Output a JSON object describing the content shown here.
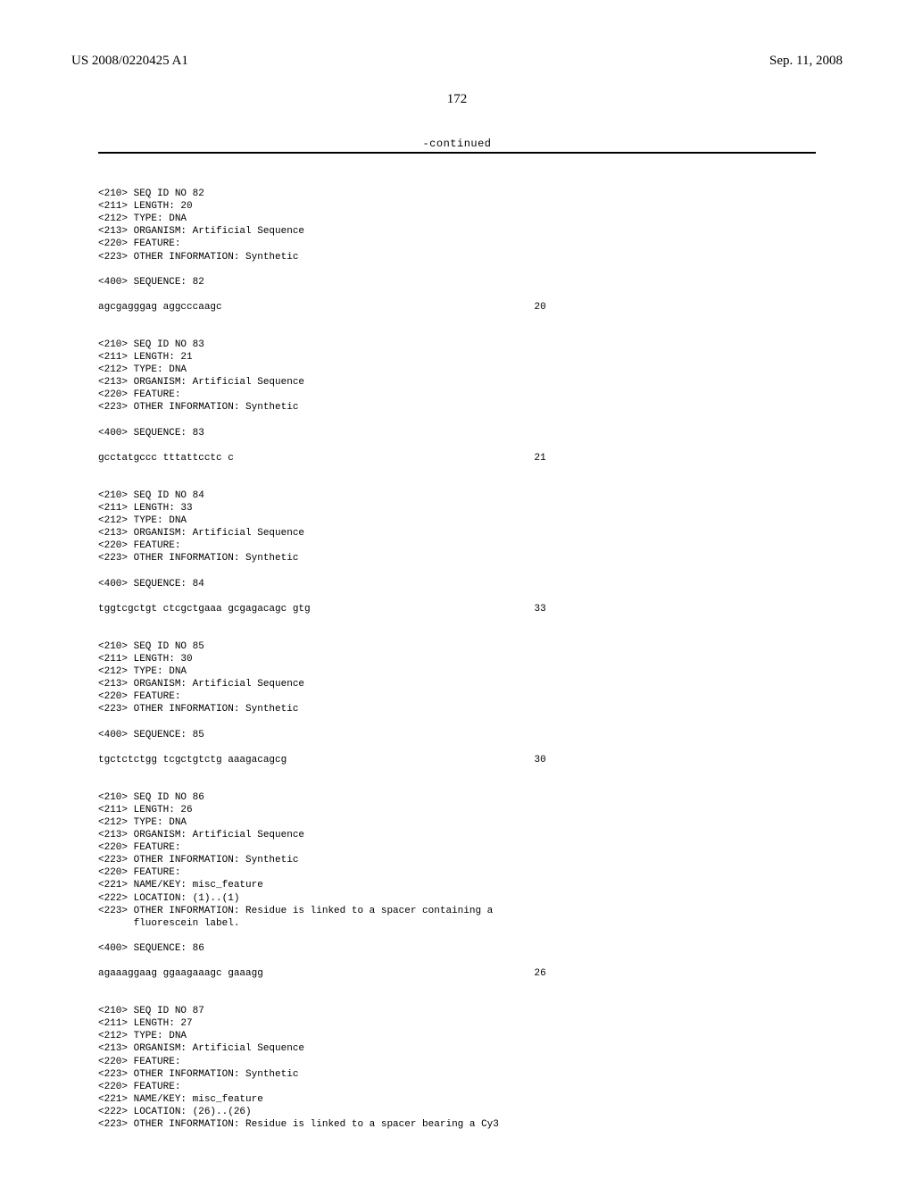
{
  "header": {
    "pub_number": "US 2008/0220425 A1",
    "pub_date": "Sep. 11, 2008"
  },
  "page_number": "172",
  "continued_label": "-continued",
  "entries": [
    {
      "lines": [
        "<210> SEQ ID NO 82",
        "<211> LENGTH: 20",
        "<212> TYPE: DNA",
        "<213> ORGANISM: Artificial Sequence",
        "<220> FEATURE:",
        "<223> OTHER INFORMATION: Synthetic"
      ],
      "seq_label": "<400> SEQUENCE: 82",
      "sequence": "agcgagggag aggcccaagc",
      "length": "20"
    },
    {
      "lines": [
        "<210> SEQ ID NO 83",
        "<211> LENGTH: 21",
        "<212> TYPE: DNA",
        "<213> ORGANISM: Artificial Sequence",
        "<220> FEATURE:",
        "<223> OTHER INFORMATION: Synthetic"
      ],
      "seq_label": "<400> SEQUENCE: 83",
      "sequence": "gcctatgccc tttattcctc c",
      "length": "21"
    },
    {
      "lines": [
        "<210> SEQ ID NO 84",
        "<211> LENGTH: 33",
        "<212> TYPE: DNA",
        "<213> ORGANISM: Artificial Sequence",
        "<220> FEATURE:",
        "<223> OTHER INFORMATION: Synthetic"
      ],
      "seq_label": "<400> SEQUENCE: 84",
      "sequence": "tggtcgctgt ctcgctgaaa gcgagacagc gtg",
      "length": "33"
    },
    {
      "lines": [
        "<210> SEQ ID NO 85",
        "<211> LENGTH: 30",
        "<212> TYPE: DNA",
        "<213> ORGANISM: Artificial Sequence",
        "<220> FEATURE:",
        "<223> OTHER INFORMATION: Synthetic"
      ],
      "seq_label": "<400> SEQUENCE: 85",
      "sequence": "tgctctctgg tcgctgtctg aaagacagcg",
      "length": "30"
    },
    {
      "lines": [
        "<210> SEQ ID NO 86",
        "<211> LENGTH: 26",
        "<212> TYPE: DNA",
        "<213> ORGANISM: Artificial Sequence",
        "<220> FEATURE:",
        "<223> OTHER INFORMATION: Synthetic",
        "<220> FEATURE:",
        "<221> NAME/KEY: misc_feature",
        "<222> LOCATION: (1)..(1)",
        "<223> OTHER INFORMATION: Residue is linked to a spacer containing a",
        "      fluorescein label."
      ],
      "seq_label": "<400> SEQUENCE: 86",
      "sequence": "agaaaggaag ggaagaaagc gaaagg",
      "length": "26"
    },
    {
      "lines": [
        "<210> SEQ ID NO 87",
        "<211> LENGTH: 27",
        "<212> TYPE: DNA",
        "<213> ORGANISM: Artificial Sequence",
        "<220> FEATURE:",
        "<223> OTHER INFORMATION: Synthetic",
        "<220> FEATURE:",
        "<221> NAME/KEY: misc_feature",
        "<222> LOCATION: (26)..(26)",
        "<223> OTHER INFORMATION: Residue is linked to a spacer bearing a Cy3"
      ],
      "seq_label": "",
      "sequence": "",
      "length": ""
    }
  ]
}
